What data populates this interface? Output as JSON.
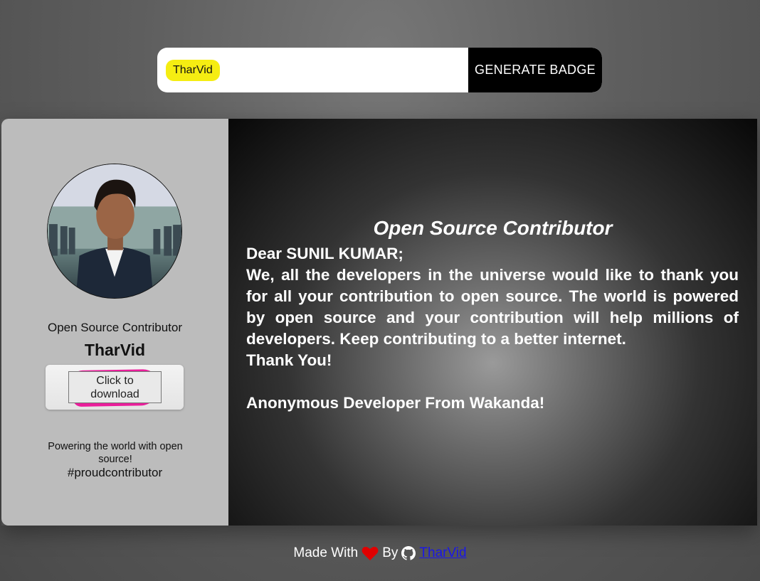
{
  "generator": {
    "input_value": "TharVid",
    "button_label": "GENERATE BADGE"
  },
  "badge": {
    "avatar_alt": "profile photo",
    "role": "Open Source Contributor",
    "username": "TharVid",
    "download_label_line1": "Click to",
    "download_label_line2": "download",
    "tagline": "Powering the world with open source!",
    "hashtag": "#proudcontributor",
    "certificate": {
      "title": "Open Source Contributor",
      "greeting": "Dear SUNIL KUMAR;",
      "message": "We, all the developers in the universe would like to thank you for all your contribution to open source. The world is powered by open source and your contribution will help millions of developers. Keep contributing to a better internet.",
      "thanks": "Thank You!",
      "signature": "Anonymous Developer From Wakanda!"
    }
  },
  "footer": {
    "made_with": "Made With",
    "by": "By",
    "author_link": "TharVid",
    "heart_icon": "heart-icon",
    "github_icon": "github-icon"
  },
  "colors": {
    "input_highlight": "#f5ed12",
    "download_highlight": "#ea1e9b",
    "heart": "#e00000",
    "link": "#1a17e6"
  }
}
